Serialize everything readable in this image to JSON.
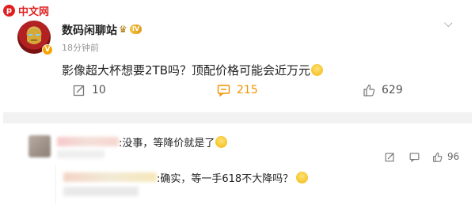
{
  "watermark": {
    "logo_char": "p",
    "text": "中文网"
  },
  "post": {
    "username": "数码闲聊站",
    "level_badge": "IV",
    "time": "18分钟前",
    "content": "影像超大杯想要2TB吗？顶配价格可能会近万元",
    "more_icon": "chevron-down-icon",
    "actions": {
      "repost_count": "10",
      "comment_count": "215",
      "like_count": "629"
    },
    "accent_color": "#f29100"
  },
  "comments": [
    {
      "text": ":没事，等降价就是了",
      "like_count": "96"
    },
    {
      "text": ":确实，等一手618不大降吗？"
    }
  ]
}
